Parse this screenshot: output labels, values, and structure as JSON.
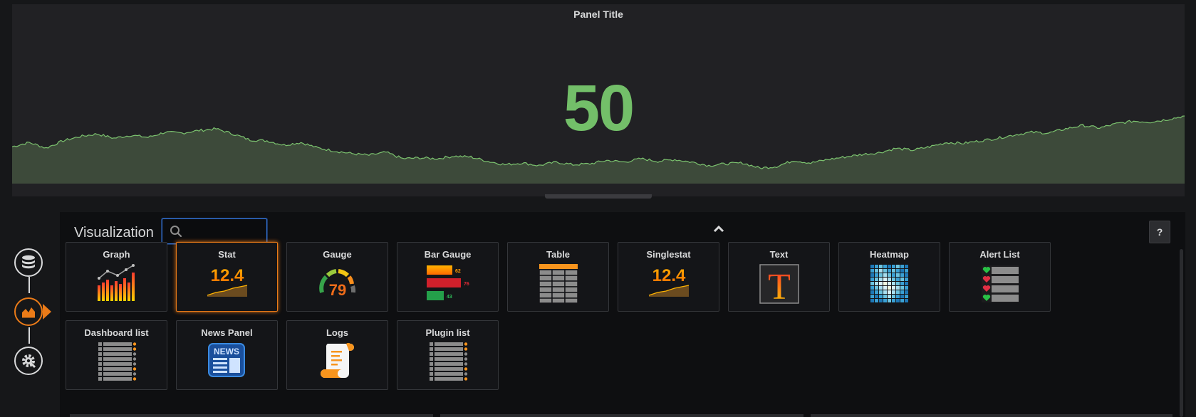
{
  "panel": {
    "title": "Panel Title",
    "value": "50",
    "colors": {
      "value": "#73bf69",
      "fill": "#3d4a3a",
      "line": "#7cc36f"
    },
    "spark": [
      0.58,
      0.68,
      0.55,
      0.72,
      0.82,
      0.88,
      0.78,
      0.85,
      0.8,
      0.92,
      0.9,
      0.96,
      1.0,
      0.88,
      0.74,
      0.72,
      0.62,
      0.68,
      0.55,
      0.48,
      0.42,
      0.38,
      0.45,
      0.3,
      0.32,
      0.3,
      0.36,
      0.34,
      0.24,
      0.16,
      0.2,
      0.14,
      0.22,
      0.16,
      0.18,
      0.26,
      0.22,
      0.3,
      0.24,
      0.28,
      0.22,
      0.14,
      0.18,
      0.2,
      0.08,
      0.12,
      0.26,
      0.2,
      0.28,
      0.34,
      0.4,
      0.44,
      0.54,
      0.5,
      0.58,
      0.68,
      0.66,
      0.72,
      0.78,
      0.86,
      0.92,
      0.9,
      1.0,
      1.08,
      1.02,
      1.12,
      1.18,
      1.16,
      1.22,
      1.3
    ]
  },
  "editor": {
    "title": "Visualization",
    "search": {
      "value": "",
      "placeholder": ""
    },
    "help_label": "?",
    "cards": [
      {
        "id": "graph",
        "label": "Graph",
        "icon": "graph-icon",
        "selected": false
      },
      {
        "id": "stat",
        "label": "Stat",
        "icon": "stat-icon",
        "selected": true
      },
      {
        "id": "gauge",
        "label": "Gauge",
        "icon": "gauge-icon",
        "selected": false
      },
      {
        "id": "bar-gauge",
        "label": "Bar Gauge",
        "icon": "bar-gauge-icon",
        "selected": false
      },
      {
        "id": "table",
        "label": "Table",
        "icon": "table-icon",
        "selected": false
      },
      {
        "id": "singlestat",
        "label": "Singlestat",
        "icon": "singlestat-icon",
        "selected": false
      },
      {
        "id": "text",
        "label": "Text",
        "icon": "text-icon",
        "selected": false
      },
      {
        "id": "heatmap",
        "label": "Heatmap",
        "icon": "heatmap-icon",
        "selected": false
      },
      {
        "id": "alert-list",
        "label": "Alert List",
        "icon": "alert-list-icon",
        "selected": false
      },
      {
        "id": "dashboard-list",
        "label": "Dashboard list",
        "icon": "dashboard-list-icon",
        "selected": false
      },
      {
        "id": "news-panel",
        "label": "News Panel",
        "icon": "news-icon",
        "selected": false
      },
      {
        "id": "logs",
        "label": "Logs",
        "icon": "logs-icon",
        "selected": false
      },
      {
        "id": "plugin-list",
        "label": "Plugin list",
        "icon": "plugin-list-icon",
        "selected": false
      }
    ],
    "icon_text": {
      "stat": "12.4",
      "singlestat": "12.4",
      "gauge": "79",
      "bar_gauge": [
        "62",
        "76",
        "43"
      ],
      "text": "T",
      "news": "NEWS"
    }
  },
  "steps": [
    {
      "id": "queries",
      "icon": "database-icon",
      "active": false
    },
    {
      "id": "visualization",
      "icon": "visualization-icon",
      "active": true
    },
    {
      "id": "general",
      "icon": "gear-icon",
      "active": false
    }
  ],
  "colors": {
    "accent": "#eb7b18",
    "focus": "#3274d9"
  }
}
